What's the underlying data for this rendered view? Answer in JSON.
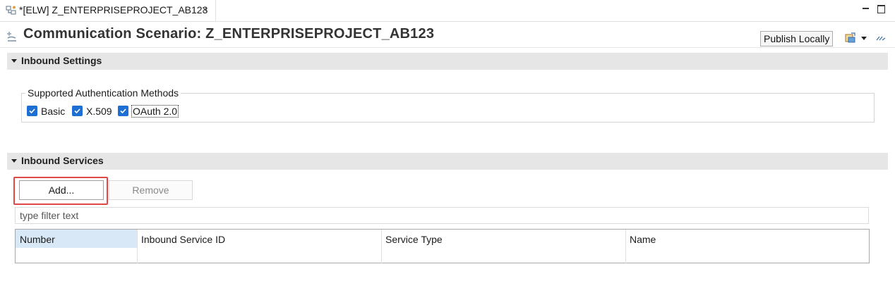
{
  "tab": {
    "label": "*[ELW] Z_ENTERPRISEPROJECT_AB123",
    "close": "×"
  },
  "header": {
    "title": "Communication Scenario: Z_ENTERPRISEPROJECT_AB123",
    "publish_label": "Publish Locally"
  },
  "inbound_settings": {
    "title": "Inbound Settings",
    "group_label": "Supported Authentication Methods",
    "methods": [
      {
        "label": "Basic",
        "checked": true
      },
      {
        "label": "X.509",
        "checked": true
      },
      {
        "label": "OAuth 2.0",
        "checked": true
      }
    ]
  },
  "inbound_services": {
    "title": "Inbound Services",
    "add_label": "Add...",
    "remove_label": "Remove",
    "filter_placeholder": "type filter text",
    "columns": [
      "Number",
      "Inbound Service ID",
      "Service Type",
      "Name"
    ],
    "rows": []
  },
  "colors": {
    "accent": "#1f6ed4",
    "highlight_frame": "#e04848",
    "selected_header": "#d9e8f6",
    "section_bg": "#e6e6e6"
  },
  "icons": [
    "scenario-tab-icon",
    "close-icon",
    "minimize-icon",
    "maximize-icon",
    "scenario-icon",
    "export-icon",
    "dropdown-icon",
    "more-icon",
    "collapse-arrow-icon",
    "checkmark-icon"
  ]
}
